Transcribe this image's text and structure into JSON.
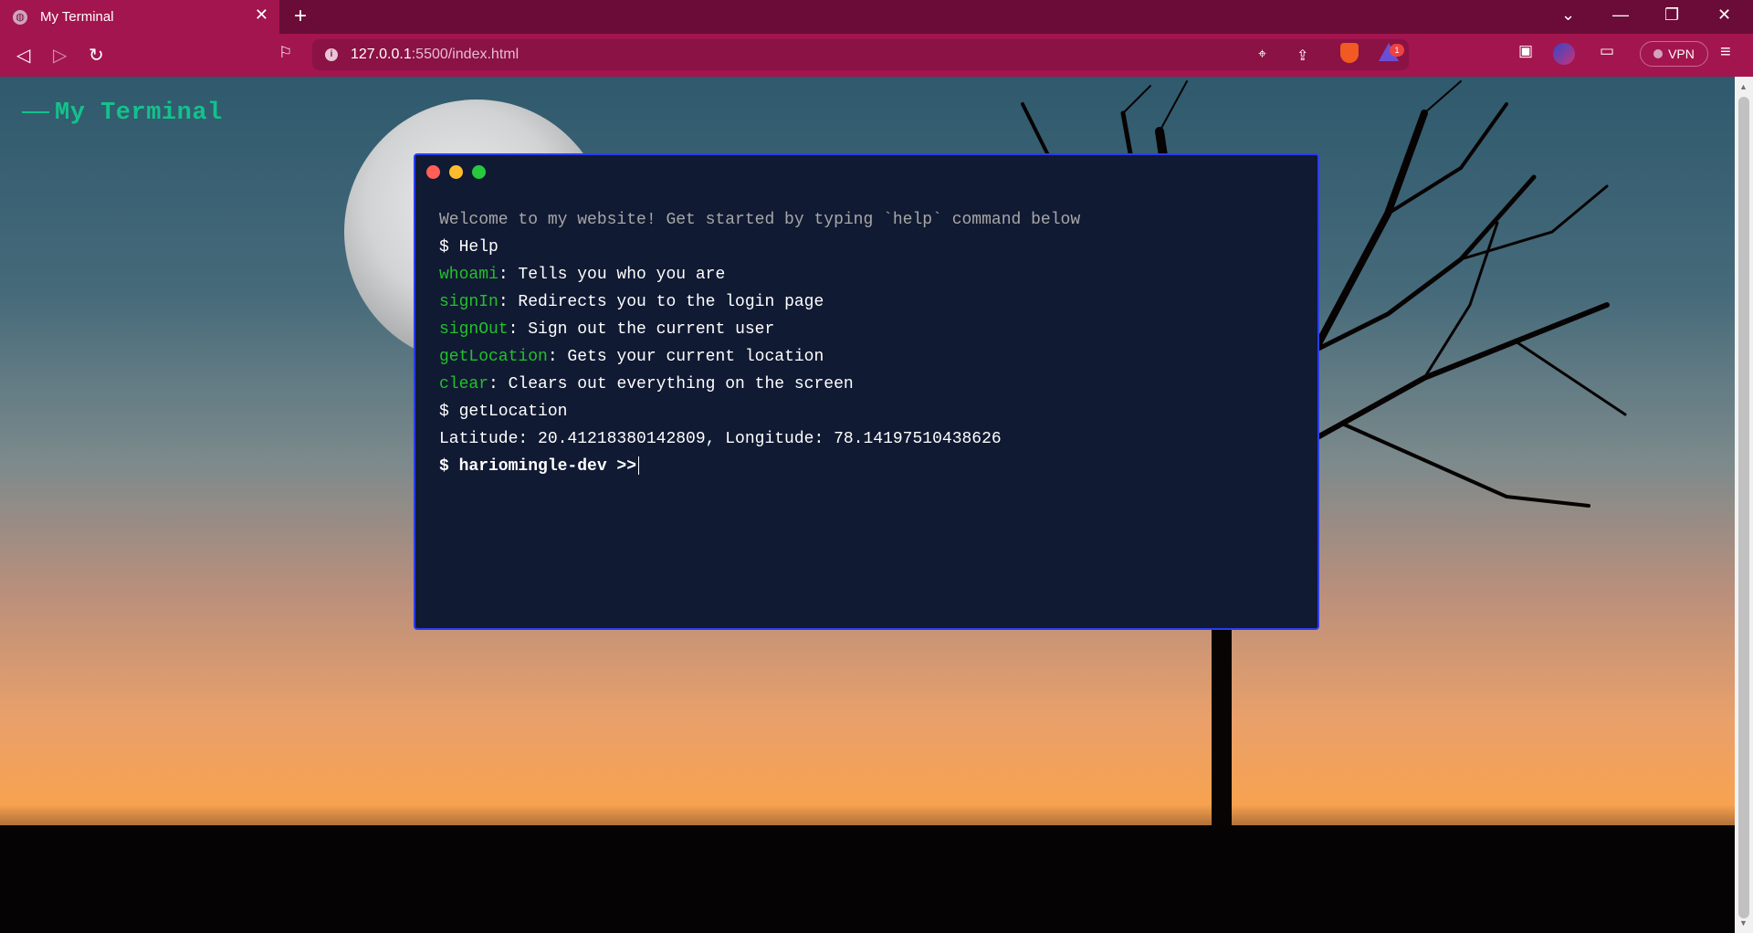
{
  "browser": {
    "tab_title": "My Terminal",
    "tab_close": "✕",
    "new_tab": "+",
    "url_host": "127.0.0.1",
    "url_path": ":5500/index.html",
    "rewards_badge": "1",
    "vpn_label": "VPN",
    "window_controls": {
      "dropdown": "⌄",
      "minimize": "—",
      "restore": "❐",
      "close": "✕"
    },
    "nav": {
      "back": "◁",
      "forward": "▷",
      "reload": "↻",
      "bookmark": "⌗"
    }
  },
  "page": {
    "title": "My Terminal"
  },
  "terminal": {
    "welcome": "Welcome to my website! Get started by typing `help` command below",
    "history_1": "$ Help",
    "commands": [
      {
        "name": "whoami",
        "desc": ": Tells you who you are"
      },
      {
        "name": "signIn",
        "desc": ": Redirects you to the login page"
      },
      {
        "name": "signOut",
        "desc": ": Sign out the current user"
      },
      {
        "name": "getLocation",
        "desc": ": Gets your current location"
      },
      {
        "name": "clear",
        "desc": ": Clears out everything on the screen"
      }
    ],
    "history_2": "$ getLocation",
    "location_output": "Latitude: 20.41218380142809, Longitude: 78.14197510438626",
    "prompt": "$ hariomingle-dev >>"
  },
  "colors": {
    "accent_green": "#14c18b",
    "command_green": "#22c12a",
    "terminal_bg": "#111a33",
    "terminal_border": "#2b3df2",
    "browser_chrome": "#a3154f"
  },
  "icons": [
    "globe-icon",
    "close-icon",
    "plus-icon",
    "back-icon",
    "forward-icon",
    "reload-icon",
    "bookmark-icon",
    "info-icon",
    "location-icon",
    "share-icon",
    "brave-shield-icon",
    "rewards-icon",
    "sidebar-icon",
    "profile-icon",
    "wallet-icon",
    "menu-icon"
  ]
}
